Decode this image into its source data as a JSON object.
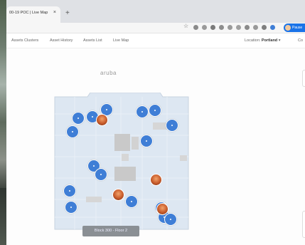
{
  "browser": {
    "tab_title": "00-19 POC | Live Map",
    "tab_close": "×",
    "new_tab": "+",
    "profile_label": "Pause"
  },
  "nav": {
    "items": [
      "Assets Clusters",
      "Asset History",
      "Assets List",
      "Live Map"
    ],
    "location_label": "Location:",
    "location_value": "Portland",
    "overflow": "Co"
  },
  "map": {
    "brand": "aruba",
    "floor_label": "Block 300 - Floor 2",
    "asset_markers": 16,
    "people_markers": 4
  },
  "colors": {
    "marker": "#3f7ed6",
    "person": "#c75a2a",
    "accent": "#1a73e8"
  }
}
